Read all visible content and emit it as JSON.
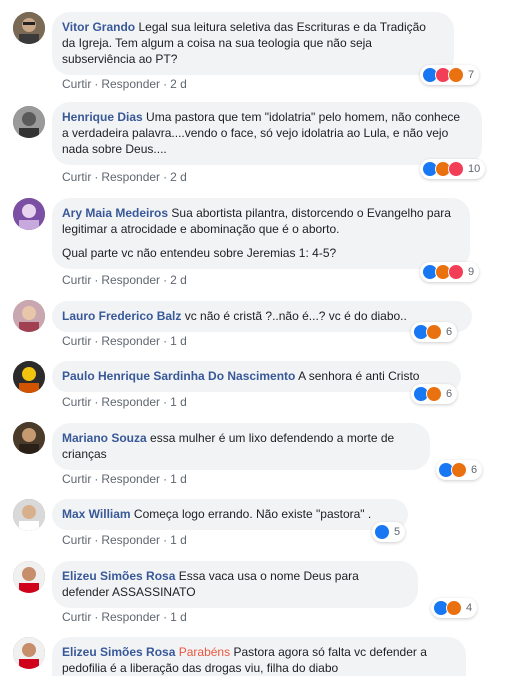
{
  "actions": {
    "like": "Curtir",
    "reply": "Responder",
    "dot": "·"
  },
  "comments": [
    {
      "name": "Vitor Grando",
      "text": "Legal sua leitura seletiva das Escrituras e da Tradição da Igreja. Tem algum a coisa na sua teologia que não seja subserviência ao PT?",
      "time": "2 d",
      "reaction_count": "7",
      "reactions": [
        "like-icon",
        "love-icon",
        "angry-icon"
      ]
    },
    {
      "name": "Henrique Dias",
      "text": "Uma pastora que tem \"idolatria\" pelo homem, não conhece a verdadeira palavra....vendo o face, só vejo idolatria ao Lula, e não vejo nada sobre Deus....",
      "time": "2 d",
      "reaction_count": "10",
      "reactions": [
        "like-icon",
        "angry-icon",
        "love-icon"
      ]
    },
    {
      "name": "Ary Maia Medeiros",
      "text": "Sua abortista pilantra, distorcendo o Evangelho para legitimar a atrocidade e abominação que é o aborto.",
      "text2": "Qual parte vc não entendeu sobre Jeremias 1: 4-5?",
      "time": "2 d",
      "reaction_count": "9",
      "reactions": [
        "like-icon",
        "angry-icon",
        "love-icon"
      ]
    },
    {
      "name": "Lauro Frederico Balz",
      "text": "vc não é cristã ?..não é...? vc é do diabo..",
      "time": "1 d",
      "reaction_count": "6",
      "reactions": [
        "like-icon",
        "angry-icon"
      ]
    },
    {
      "name": "Paulo Henrique Sardinha Do Nascimento",
      "text": "A senhora é anti Cristo",
      "time": "1 d",
      "reaction_count": "6",
      "reactions": [
        "like-icon",
        "angry-icon"
      ]
    },
    {
      "name": "Mariano Souza",
      "text": "essa mulher é um lixo defendendo a morte de crianças",
      "time": "1 d",
      "reaction_count": "6",
      "reactions": [
        "like-icon",
        "angry-icon"
      ]
    },
    {
      "name": "Max William",
      "text": "Começa logo errando. Não existe \"pastora\" .",
      "time": "1 d",
      "reaction_count": "5",
      "reactions": [
        "like-icon"
      ]
    },
    {
      "name": "Elizeu Simões Rosa",
      "text": "Essa vaca usa o nome Deus para defender ASSASSINATO",
      "time": "1 d",
      "reaction_count": "4",
      "reactions": [
        "like-icon",
        "angry-icon"
      ]
    },
    {
      "name": "Elizeu Simões Rosa",
      "mention": "Parabéns",
      "text": "Pastora agora só falta vc defender a pedofilia é a liberação das drogas viu, filha do diabo",
      "time": "",
      "reaction_count": "",
      "reactions": []
    }
  ],
  "colors": {
    "name": "#385898",
    "bubble": "#f2f3f5",
    "meta": "#606770",
    "like": "#1877f2",
    "love": "#f33e58",
    "angry": "#e9710f"
  }
}
